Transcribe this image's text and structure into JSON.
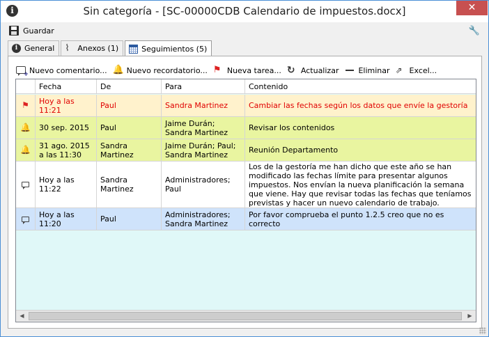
{
  "window": {
    "title": "Sin categoría - [SC-00000CDB Calendario de impuestos.docx]",
    "info_icon": "i",
    "close_label": "✕"
  },
  "menu": {
    "save_label": "Guardar"
  },
  "tabs": [
    {
      "label": "General",
      "icon": "info-icon",
      "active": false
    },
    {
      "label": "Anexos (1)",
      "icon": "paperclip-icon",
      "active": false
    },
    {
      "label": "Seguimientos (5)",
      "icon": "calendar-icon",
      "active": true
    }
  ],
  "toolbar": {
    "new_comment": "Nuevo comentario...",
    "new_reminder": "Nuevo recordatorio...",
    "new_task": "Nueva tarea...",
    "refresh": "Actualizar",
    "delete": "Eliminar",
    "excel": "Excel..."
  },
  "grid": {
    "columns": [
      "",
      "Fecha",
      "De",
      "Para",
      "Contenido"
    ],
    "rows": [
      {
        "type": "flag",
        "icon": "flag-icon",
        "bg": "#fff2cc",
        "color": "#e00000",
        "fecha": "Hoy a las 11:21",
        "de": "Paul",
        "para": "Sandra Martinez",
        "contenido": "Cambiar las fechas según los datos que envíe la gestoría"
      },
      {
        "type": "reminder",
        "icon": "bell-icon",
        "bg": "#e9f5a0",
        "color": "#000000",
        "fecha": "30 sep. 2015",
        "de": "Paul",
        "para": "Jaime Durán; Sandra Martinez",
        "contenido": "Revisar los contenidos"
      },
      {
        "type": "reminder",
        "icon": "bell-icon",
        "bg": "#e9f5a0",
        "color": "#000000",
        "fecha": "31 ago. 2015 a las 11:30",
        "de": "Sandra Martinez",
        "para": "Jaime Durán; Paul; Sandra Martinez",
        "contenido": "Reunión Departamento"
      },
      {
        "type": "comment",
        "icon": "comment-icon",
        "bg": "#ffffff",
        "color": "#000000",
        "fecha": "Hoy a las 11:22",
        "de": "Sandra Martinez",
        "para": "Administradores; Paul",
        "contenido": "Los de la gestoría me han dicho que este año se han modificado las fechas límite para presentar algunos impuestos. Nos envían la nueva planificación la semana que viene. Hay que revisar todas las fechas que teníamos previstas y hacer un nuevo calendario de trabajo."
      },
      {
        "type": "comment",
        "icon": "comment-icon",
        "bg": "#cfe3fb",
        "color": "#000000",
        "fecha": "Hoy a las 11:20",
        "de": "Paul",
        "para": "Administradores; Sandra Martinez",
        "contenido": "Por favor comprueba el punto 1.2.5  creo que no es correcto"
      }
    ]
  }
}
